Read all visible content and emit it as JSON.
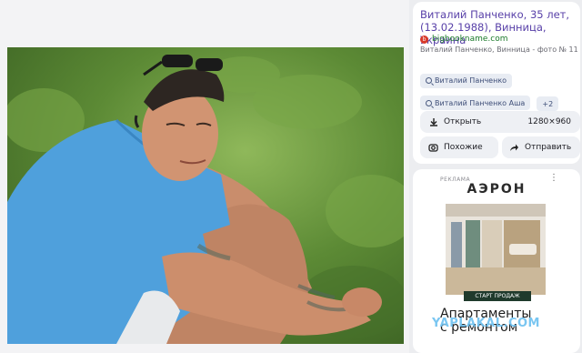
{
  "result": {
    "title": "Виталий Панченко, 35 лет, (13.02.1988), Винница, Украина",
    "source": "bigbookname.com",
    "source_icon": "bigbookname-logo-icon",
    "subtitle": "Виталий Панченко, Винница - фото № 11",
    "tags": [
      "Виталий Панченко",
      "Виталий Панченко Аша"
    ],
    "more_tags": "+2",
    "open_label": "Открыть",
    "image_size": "1280×960",
    "similar_label": "Похожие",
    "send_label": "Отправить"
  },
  "ad": {
    "label": "РЕКЛАМА",
    "menu": "⋮",
    "brand": "АЭРОН",
    "promo": "СТАРТ ПРОДАЖ",
    "headline_line1": "Апартаменты",
    "headline_line2": "с ремонтом"
  },
  "watermark": "YAPLAKAL.COM",
  "colors": {
    "title": "#5840a8",
    "source": "#1a7a2a",
    "button_bg": "#eef0f4",
    "tag_bg": "#e8ecf3",
    "watermark": "#6cc0f0"
  }
}
